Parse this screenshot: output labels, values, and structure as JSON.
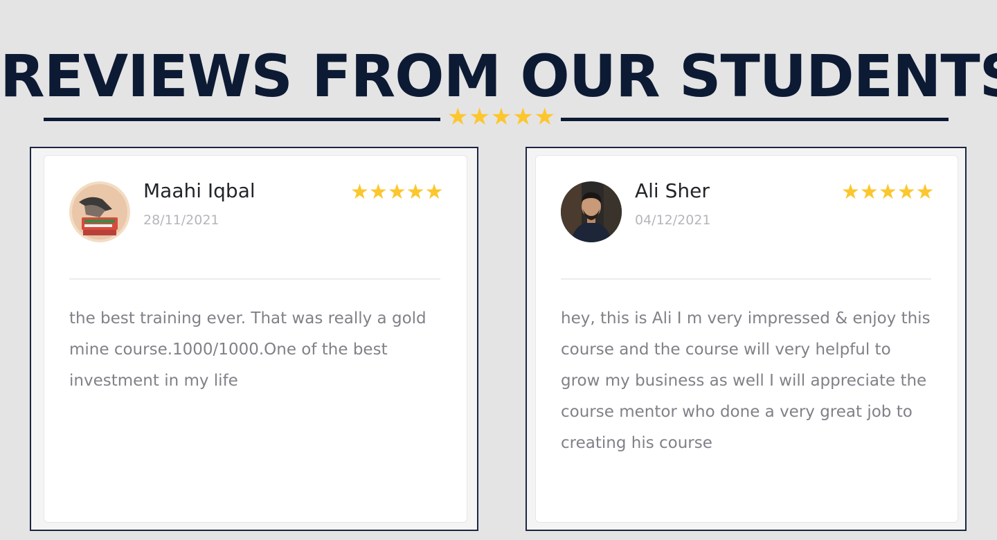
{
  "header": {
    "title": "REVIEWS FROM OUR STUDENTS",
    "rating_stars": 5
  },
  "colors": {
    "title": "#0d1a33",
    "star": "#fcc62d",
    "background": "#e4e4e5",
    "card": "#ffffff",
    "text_muted": "#808188"
  },
  "reviews": [
    {
      "name": "Maahi Iqbal",
      "date": "28/11/2021",
      "rating": 5,
      "text": "the best training ever. That was really a gold mine course.1000/1000.One of the best investment in my life",
      "avatar_icon": "avatar-photo"
    },
    {
      "name": "Ali Sher",
      "date": "04/12/2021",
      "rating": 5,
      "text": "hey, this is Ali I m very impressed & enjoy this course and the course will very helpful to grow my business as well I will appreciate the course mentor who done a very great job to creating his course",
      "avatar_icon": "avatar-photo"
    }
  ]
}
